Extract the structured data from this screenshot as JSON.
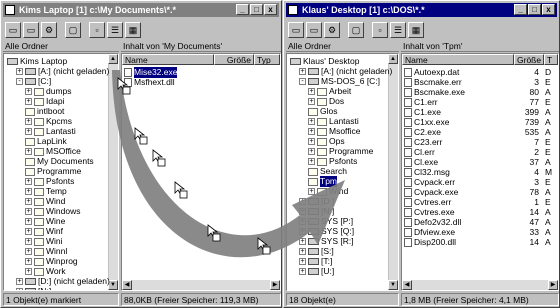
{
  "left_window": {
    "title": "Kims Laptop [1] c:\\My Documents\\*.*",
    "folders_header": "Alle Ordner",
    "contents_header": "Inhalt von 'My Documents'",
    "columns": [
      "Name",
      "Größe",
      "Typ"
    ],
    "tree": [
      "Kims Laptop",
      "[A:] (nicht geladen)",
      "[C:]",
      "dumps",
      "Idapi",
      "intlboot",
      "Kpcms",
      "Lantasti",
      "LapLink",
      "MSOffice",
      "My Documents",
      "Programme",
      "Psfonts",
      "Temp",
      "Wind",
      "Windows",
      "Wine",
      "Winf",
      "Wini",
      "Winnl",
      "Winprog",
      "Work",
      "[D:] (nicht geladen)",
      "[N:]"
    ],
    "files": [
      "Mise32.exe",
      "Msfhext.dll"
    ],
    "status_left": "1 Objekt(e) markiert",
    "status_right": "88,0KB (Freier Speicher: 119,3 MB)"
  },
  "right_window": {
    "title": "Klaus' Desktop [1] c:\\DOS\\*.*",
    "folders_header": "Alle Ordner",
    "contents_header": "Inhalt von 'Tpm'",
    "columns": [
      "Name",
      "Größe",
      "T"
    ],
    "tree": [
      "Klaus' Desktop",
      "[A:] (nicht geladen)",
      "MS-DOS_6 [C:]",
      "Arbeit",
      "Dos",
      "Glos",
      "Lantasti",
      "Msoffice",
      "Ops",
      "Programme",
      "Psfonts",
      "Search",
      "Tpm",
      "Wind",
      "[D:]",
      "[N:]",
      "SYS [P:]",
      "SYS [Q:]",
      "SYS [R:]",
      "[S:]",
      "[T:]",
      "[U:]"
    ],
    "files": [
      {
        "name": "Autoexp.dat",
        "size": "4",
        "type": "D"
      },
      {
        "name": "Bscmake.err",
        "size": "3",
        "type": "E"
      },
      {
        "name": "Bscmake.exe",
        "size": "80",
        "type": "A"
      },
      {
        "name": "C1.err",
        "size": "77",
        "type": "E"
      },
      {
        "name": "C1.exe",
        "size": "399",
        "type": "A"
      },
      {
        "name": "C1xx.exe",
        "size": "739",
        "type": "A"
      },
      {
        "name": "C2.exe",
        "size": "535",
        "type": "A"
      },
      {
        "name": "C23.err",
        "size": "7",
        "type": "E"
      },
      {
        "name": "Cl.err",
        "size": "2",
        "type": "E"
      },
      {
        "name": "Cl.exe",
        "size": "37",
        "type": "A"
      },
      {
        "name": "Cl32.msg",
        "size": "4",
        "type": "M"
      },
      {
        "name": "Cvpack.err",
        "size": "3",
        "type": "E"
      },
      {
        "name": "Cvpack.exe",
        "size": "78",
        "type": "A"
      },
      {
        "name": "Cvtres.err",
        "size": "1",
        "type": "E"
      },
      {
        "name": "Cvtres.exe",
        "size": "14",
        "type": "A"
      },
      {
        "name": "Defo2v32.dll",
        "size": "47",
        "type": "A"
      },
      {
        "name": "Dfview.exe",
        "size": "33",
        "type": "A"
      },
      {
        "name": "Disp200.dll",
        "size": "14",
        "type": "A"
      }
    ],
    "status_left": "18 Objekt(e)",
    "status_right": "1,8 MB (Freier Speicher: 4,1 MB)"
  },
  "window_buttons": [
    "_",
    "□",
    "x"
  ],
  "colors": {
    "title_active": "#000080",
    "title_inactive": "#808080",
    "arrow": "#808080"
  }
}
